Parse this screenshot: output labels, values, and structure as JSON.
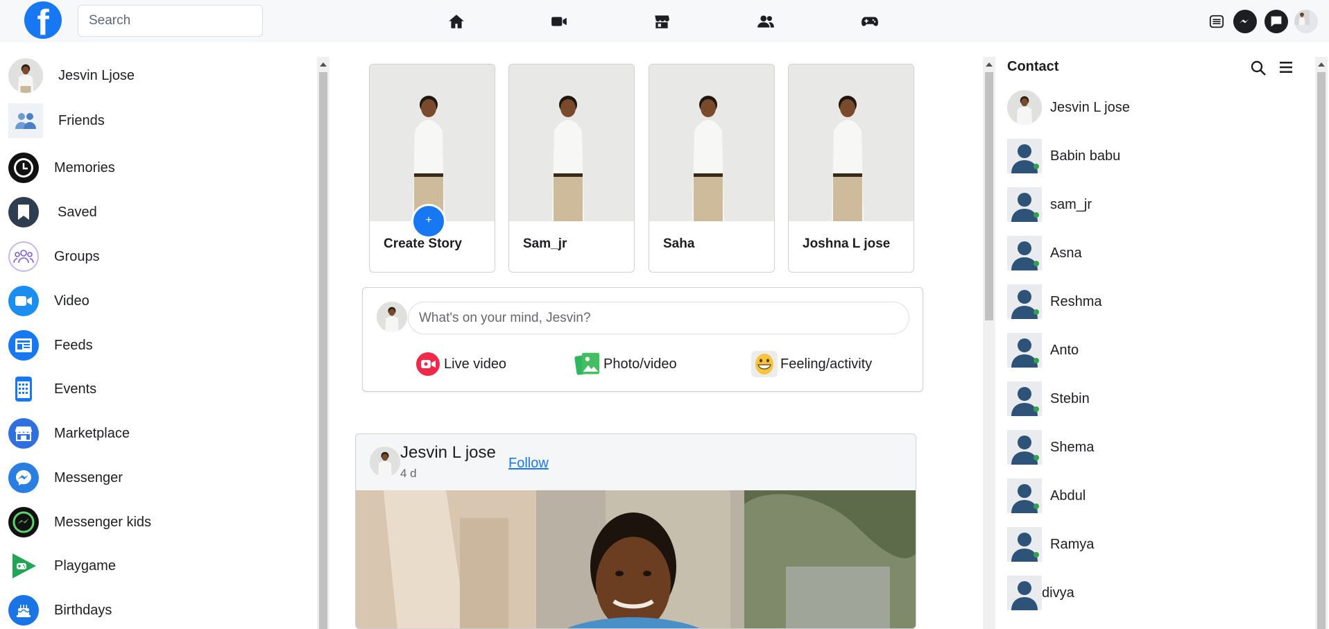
{
  "topbar": {
    "logo_letter": "f",
    "search_placeholder": "Search",
    "nav": [
      "home-icon",
      "video-icon",
      "marketplace-icon",
      "friends-icon",
      "gaming-icon"
    ],
    "right": [
      "menu-icon",
      "messenger-icon",
      "chat-icon",
      "account-avatar"
    ]
  },
  "sidebar": {
    "profile_name": "Jesvin Ljose",
    "items": [
      {
        "label": "Friends",
        "icon": "friends-icon"
      },
      {
        "label": "Memories",
        "icon": "memories-icon"
      },
      {
        "label": "Saved",
        "icon": "saved-icon"
      },
      {
        "label": "Groups",
        "icon": "groups-icon"
      },
      {
        "label": "Video",
        "icon": "video-icon"
      },
      {
        "label": "Feeds",
        "icon": "feeds-icon"
      },
      {
        "label": "Events",
        "icon": "events-icon"
      },
      {
        "label": "Marketplace",
        "icon": "marketplace-icon"
      },
      {
        "label": "Messenger",
        "icon": "messenger-icon"
      },
      {
        "label": "Messenger kids",
        "icon": "messenger-kids-icon"
      },
      {
        "label": "Playgame",
        "icon": "playgame-icon"
      },
      {
        "label": "Birthdays",
        "icon": "birthdays-icon"
      }
    ]
  },
  "stories": [
    {
      "name": "Create Story"
    },
    {
      "name": "Sam_jr"
    },
    {
      "name": "Saha"
    },
    {
      "name": "Joshna L jose"
    }
  ],
  "story_plus": "+",
  "composer": {
    "placeholder": "What's on your mind, Jesvin?",
    "actions": [
      {
        "label": "Live video",
        "icon": "live-video-icon"
      },
      {
        "label": "Photo/video",
        "icon": "photo-video-icon"
      },
      {
        "label": "Feeling/activity",
        "icon": "feeling-icon"
      }
    ]
  },
  "post": {
    "author": "Jesvin L jose",
    "time": "4 d",
    "follow_label": "Follow"
  },
  "contacts": {
    "title": "Contact",
    "list": [
      {
        "name": "Jesvin L jose"
      },
      {
        "name": "Babin babu"
      },
      {
        "name": "sam_jr"
      },
      {
        "name": "Asna"
      },
      {
        "name": "Reshma"
      },
      {
        "name": "Anto"
      },
      {
        "name": "Stebin"
      },
      {
        "name": "Shema"
      },
      {
        "name": "Abdul"
      },
      {
        "name": "Ramya"
      },
      {
        "name": "divya"
      }
    ]
  },
  "colors": {
    "brand": "#1877f2",
    "online": "#31a24c",
    "contact_silhouette": "#2d5478"
  }
}
